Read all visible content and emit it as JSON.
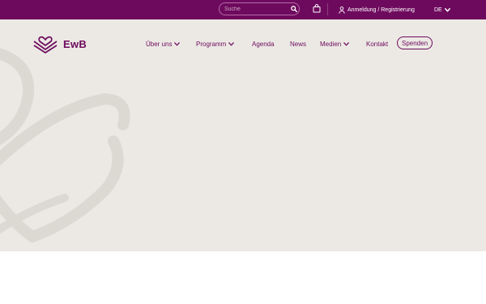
{
  "topbar": {
    "search": {
      "placeholder": "Suche",
      "value": "",
      "icon": "search-icon"
    },
    "cart": {
      "icon": "shopping-bag-icon"
    },
    "login": {
      "icon": "user-icon",
      "label": "Anmeldung / Registrierung"
    },
    "language": {
      "label": "DE",
      "icon": "chevron-down-icon"
    }
  },
  "header": {
    "logo": {
      "text": "EwB",
      "icon": "book-heart-logo"
    },
    "nav": [
      {
        "label": "Über uns",
        "has_dropdown": true
      },
      {
        "label": "Programm",
        "has_dropdown": true
      },
      {
        "label": "Agenda",
        "has_dropdown": false
      },
      {
        "label": "News",
        "has_dropdown": false
      },
      {
        "label": "Medien",
        "has_dropdown": true
      },
      {
        "label": "Kontakt",
        "has_dropdown": false
      }
    ],
    "cta": {
      "label": "Spenden"
    }
  },
  "colors": {
    "brand": "#6e0a5e",
    "hero_background": "#ece9e4",
    "hero_decoration": "#dcd8d2",
    "page_background": "#ffffff"
  }
}
